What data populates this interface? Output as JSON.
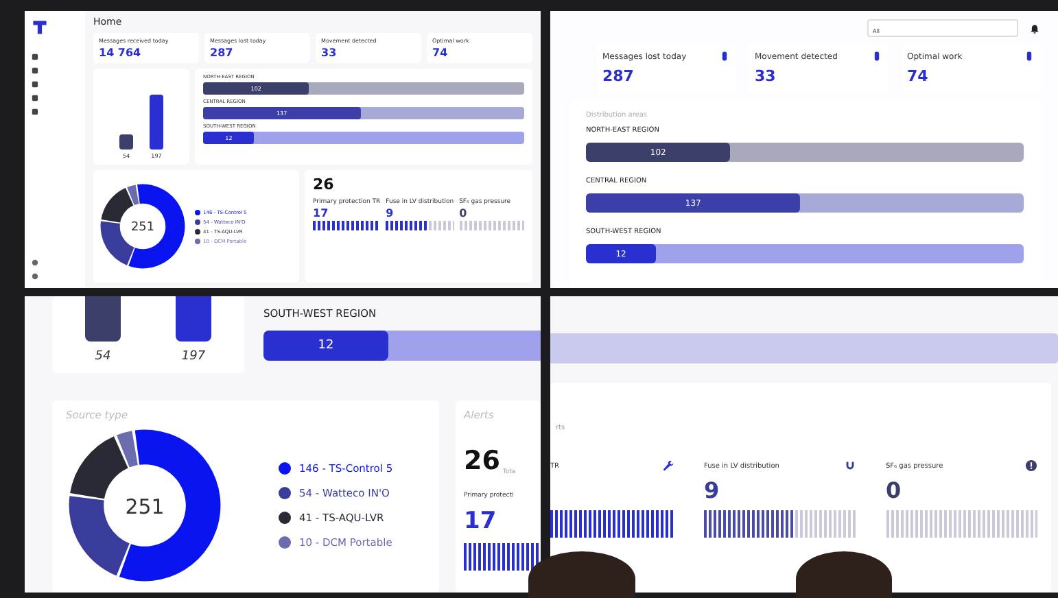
{
  "top_left_screen": {
    "title": "Home",
    "stats": [
      {
        "label": "Messages received today",
        "value": "14 764"
      },
      {
        "label": "Messages lost today",
        "value": "287"
      },
      {
        "label": "Movement detected",
        "value": "33"
      },
      {
        "label": "Optimal work",
        "value": "74"
      }
    ],
    "point_types": {
      "bar_labels": [
        "54",
        "197"
      ]
    },
    "regions": [
      {
        "name": "NORTH-EAST REGION",
        "value": "102",
        "level": 0.33,
        "color": "#3d3f6b"
      },
      {
        "name": "CENTRAL REGION",
        "value": "137",
        "level": 0.49,
        "color": "#3c3fa8"
      },
      {
        "name": "SOUTH-WEST REGION",
        "value": "12",
        "level": 0.16,
        "color": "#2a2fd0"
      }
    ],
    "source": {
      "total": "251",
      "chart_data": {
        "type": "donut",
        "categories": [
          "146 - TS-Control 5",
          "54 - Watteco IN'O",
          "41 - TS-AQU-LVR",
          "10 - DCM Portable"
        ],
        "values": [
          146,
          54,
          41,
          10
        ]
      },
      "legend": [
        {
          "color": "#0a14f0"
        },
        {
          "color": "#3a3c9c"
        },
        {
          "color": "#2a2a35"
        },
        {
          "color": "#6b6cae"
        }
      ]
    },
    "alerts": {
      "total": "26",
      "items": [
        {
          "label": "Primary protection TR",
          "value": "17",
          "level": 1
        },
        {
          "label": "Fuse in LV distribution",
          "value": "9",
          "level": 0.6
        },
        {
          "label": "SF₆ gas pressure",
          "value": "0",
          "level": 0
        }
      ]
    }
  },
  "top_right_screen": {
    "dropdown": {
      "value": "All"
    },
    "stats": [
      {
        "label": "Messages lost today",
        "value": "287"
      },
      {
        "label": "Movement detected",
        "value": "33"
      },
      {
        "label": "Optimal work",
        "value": "74"
      }
    ],
    "regions_title": "Distribution areas",
    "regions": [
      {
        "name": "NORTH-EAST REGION",
        "value": "102",
        "level": 0.33,
        "color": "#3d3f6b"
      },
      {
        "name": "CENTRAL REGION",
        "value": "137",
        "level": 0.49,
        "color": "#3c3fa8"
      },
      {
        "name": "SOUTH-WEST REGION",
        "value": "12",
        "level": 0.16,
        "color": "#2a2fd0"
      }
    ]
  },
  "bottom_left_screen": {
    "bar_labels": [
      "54",
      "197"
    ],
    "region": {
      "name": "SOUTH-WEST REGION",
      "value": "12",
      "level": 0.45,
      "color": "#2a2fd0"
    },
    "source": {
      "title": "Source type",
      "total": "251",
      "chart_data": {
        "type": "donut",
        "categories": [
          "146 - TS-Control 5",
          "54 - Watteco IN'O",
          "41 - TS-AQU-LVR",
          "10 - DCM Portable"
        ],
        "values": [
          146,
          54,
          41,
          10
        ]
      },
      "legend": [
        {
          "color": "#0a14f0"
        },
        {
          "color": "#3a3c9c"
        },
        {
          "color": "#2a2a35"
        },
        {
          "color": "#6b6cae"
        }
      ]
    },
    "alerts": {
      "title": "Alerts",
      "total": "26",
      "total_label": "Tota",
      "item": {
        "label": "Primary protecti",
        "value": "17",
        "level": 1
      }
    }
  },
  "bottom_right_screen": {
    "total_label": "rts",
    "items": [
      {
        "label": "TR",
        "kind": "wrench",
        "level": 1
      },
      {
        "label": "Fuse in LV distribution",
        "kind": "plug",
        "value": "9",
        "level": 0.6
      },
      {
        "label": "SF₆ gas pressure",
        "kind": "info",
        "value": "0",
        "level": 0
      }
    ]
  }
}
